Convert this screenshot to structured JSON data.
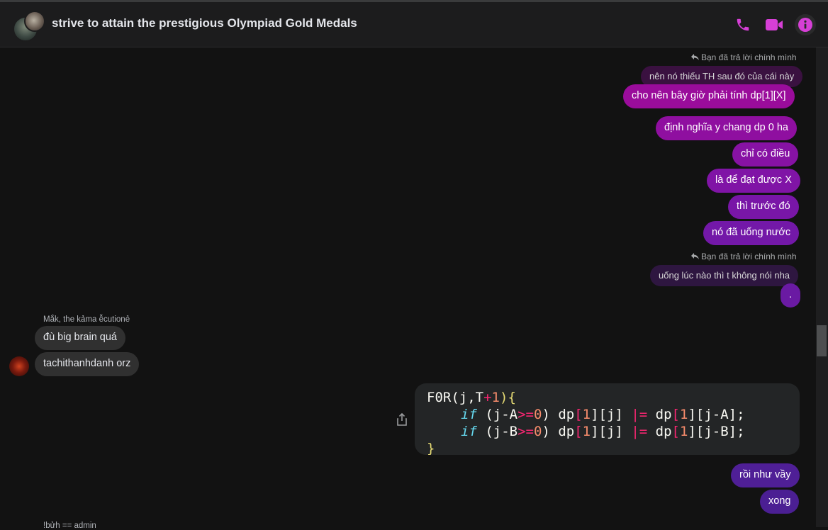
{
  "header": {
    "title": "strive to attain the prestigious Olympiad Gold Medals",
    "icons": [
      "phone-icon",
      "video-icon",
      "info-icon"
    ],
    "accent_color": "#d63fd6"
  },
  "messages": {
    "reply1": {
      "label": "Bạn đã trả lời chính mình",
      "quoted": "nên nó thiếu TH sau đó của cái này",
      "text": "cho nên bây giờ phải tính dp[1][X]"
    },
    "m1": "định nghĩa y chang dp 0 ha",
    "m2": "chỉ có điều",
    "m3": "là để đạt được X",
    "m4": "thì trước đó",
    "m5": "nó đã uống nước",
    "reply2": {
      "label": "Bạn đã trả lời chính mình",
      "quoted": "uống lúc nào thì t không nói nha",
      "text": "."
    },
    "other": {
      "sender": "Mắk, the kảma ễcutionẻ",
      "m1": "đù big brain quá",
      "m2": "tachithanhdanh orz"
    },
    "code": {
      "l1a": "F0R",
      "l1b": "(j,T",
      "l1c": "+",
      "l1d": "1",
      "l1e": "){",
      "l2a": "if",
      "l2b": " (j-A",
      "l2c": ">=",
      "l2d": "0",
      "l2e": ") dp",
      "l2f": "[",
      "l2g": "1",
      "l2h": "][j] ",
      "l2i": "|=",
      "l2j": " dp",
      "l2k": "[",
      "l2l": "1",
      "l2m": "][j-A];",
      "l3a": "if",
      "l3b": " (j-B",
      "l3c": ">=",
      "l3d": "0",
      "l3e": ") dp",
      "l3f": "[",
      "l3g": "1",
      "l3h": "][j] ",
      "l3i": "|=",
      "l3j": " dp",
      "l3k": "[",
      "l3l": "1",
      "l3m": "][j-B];",
      "l4": "}"
    },
    "m6": "rồi như vầy",
    "m7": "xong",
    "next_sender": "!bửh == admin"
  },
  "colors": {
    "bubble_magenta": "#9a0c9b",
    "bubble_purple": "#6a1aa3",
    "bubble_violet": "#4b1f93"
  }
}
